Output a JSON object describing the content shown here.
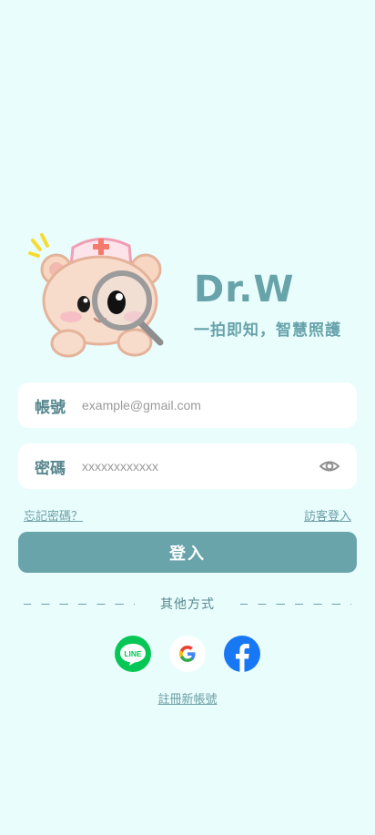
{
  "brand": {
    "title": "Dr.W",
    "slogan": "一拍即知，智慧照護"
  },
  "login_form": {
    "account_label": "帳號",
    "account_placeholder": "example@gmail.com",
    "password_label": "密碼",
    "password_placeholder": "xxxxxxxxxxxx",
    "forgot_password": "忘記密碼？",
    "guest_login": "訪客登入",
    "submit_label": "登入"
  },
  "alt_login": {
    "divider_text": "其他方式",
    "providers": [
      "LINE",
      "Google",
      "Facebook"
    ]
  },
  "register_link": "註冊新帳號",
  "colors": {
    "background": "#e9fdfd",
    "accent": "#69a4aa",
    "line_green": "#06c755",
    "facebook_blue": "#1877f2"
  },
  "icons": {
    "password_toggle": "eye-icon",
    "line": "line-icon",
    "google": "google-icon",
    "facebook": "facebook-icon"
  }
}
